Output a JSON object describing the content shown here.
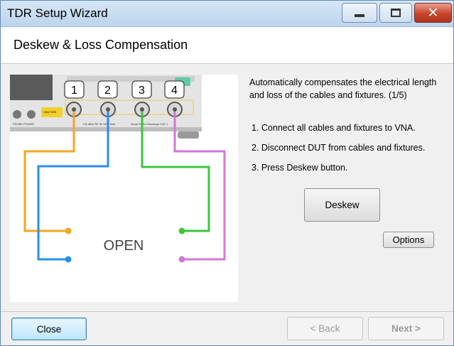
{
  "window": {
    "title": "TDR Setup Wizard"
  },
  "header": {
    "title": "Deskew & Loss Compensation"
  },
  "diagram": {
    "ports": [
      "1",
      "2",
      "3",
      "4"
    ],
    "open_label": "OPEN",
    "panel_labels": {
      "probe_power": "PROBE POWER",
      "caution": "CAUTION",
      "spec": "+26 dBm RF 35 VDC Max",
      "avoid": "Avoid Static Discharge CAT 1"
    },
    "cable_colors": {
      "port1": "#f5a623",
      "port2": "#2a8ee8",
      "port3": "#3cc63c",
      "port4": "#d078d8"
    }
  },
  "instructions": {
    "description": "Automatically compensates the electrical length and loss of the cables and fixtures. (1/5)",
    "steps": [
      "1. Connect all cables and fixtures to VNA.",
      "2. Disconnect DUT from cables and fixtures.",
      "3. Press Deskew button."
    ]
  },
  "buttons": {
    "deskew": "Deskew",
    "options": "Options",
    "close": "Close",
    "back": "< Back",
    "next": "Next >"
  }
}
